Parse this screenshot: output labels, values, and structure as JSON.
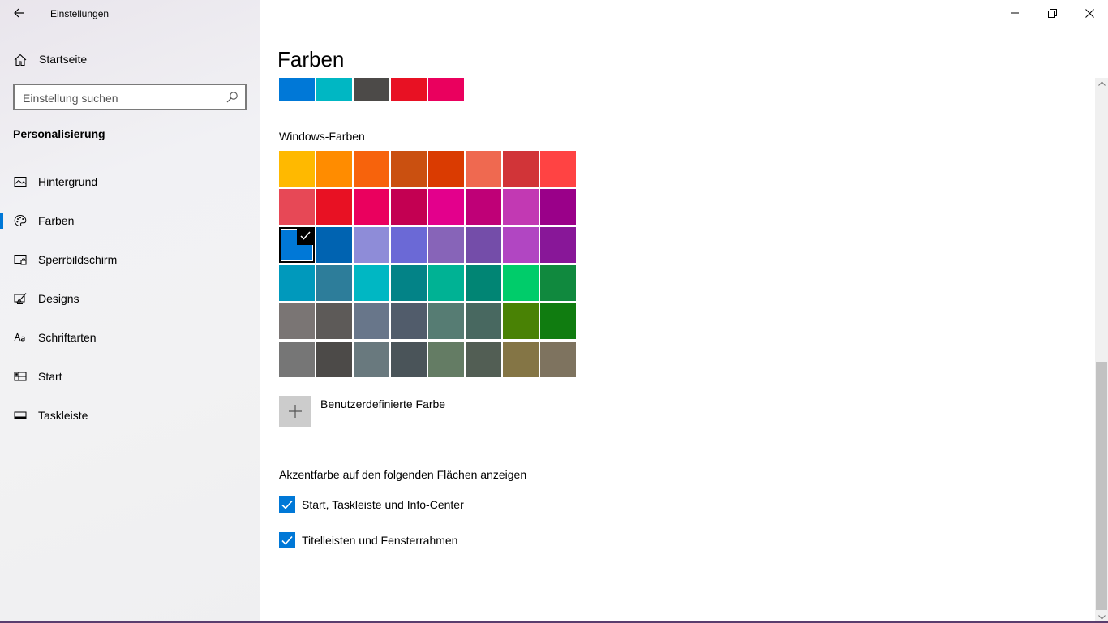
{
  "window": {
    "title": "Einstellungen"
  },
  "sidebar": {
    "home_label": "Startseite",
    "search_placeholder": "Einstellung suchen",
    "section_heading": "Personalisierung",
    "items": [
      {
        "label": "Hintergrund",
        "icon": "picture-icon",
        "active": false
      },
      {
        "label": "Farben",
        "icon": "palette-icon",
        "active": true
      },
      {
        "label": "Sperrbildschirm",
        "icon": "lock-screen-icon",
        "active": false
      },
      {
        "label": "Designs",
        "icon": "brush-icon",
        "active": false
      },
      {
        "label": "Schriftarten",
        "icon": "font-icon",
        "active": false
      },
      {
        "label": "Start",
        "icon": "start-icon",
        "active": false
      },
      {
        "label": "Taskleiste",
        "icon": "taskbar-icon",
        "active": false
      }
    ],
    "accent": "#0078d7"
  },
  "main": {
    "title": "Farben",
    "recent_colors": [
      "#0078d7",
      "#00b7c3",
      "#4c4a48",
      "#e81123",
      "#ea005e"
    ],
    "windows_colors_heading": "Windows-Farben",
    "windows_colors": [
      [
        "#ffb900",
        "#ff8c00",
        "#f7630c",
        "#ca5010",
        "#da3b01",
        "#ef6950",
        "#d13438",
        "#ff4343"
      ],
      [
        "#e74856",
        "#e81123",
        "#ea005e",
        "#c30052",
        "#e3008c",
        "#bf0077",
        "#c239b3",
        "#9a0089"
      ],
      [
        "#0078d7",
        "#0063b1",
        "#8e8cd8",
        "#6b69d6",
        "#8764b8",
        "#744da9",
        "#b146c2",
        "#881798"
      ],
      [
        "#0099bc",
        "#2d7d9a",
        "#00b7c3",
        "#038387",
        "#00b294",
        "#018574",
        "#00cc6a",
        "#10893e"
      ],
      [
        "#7a7574",
        "#5d5a58",
        "#68768a",
        "#515c6b",
        "#567c73",
        "#486860",
        "#498205",
        "#107c10"
      ],
      [
        "#767676",
        "#4c4a48",
        "#69797e",
        "#4a5459",
        "#647c64",
        "#525e54",
        "#847545",
        "#7e735f"
      ]
    ],
    "selected_color": "#0078d7",
    "custom_color_label": "Benutzerdefinierte Farbe",
    "accent_heading": "Akzentfarbe auf den folgenden Flächen anzeigen",
    "checkboxes": [
      {
        "label": "Start, Taskleiste und Info-Center",
        "checked": true
      },
      {
        "label": "Titelleisten und Fensterrahmen",
        "checked": true
      }
    ]
  }
}
